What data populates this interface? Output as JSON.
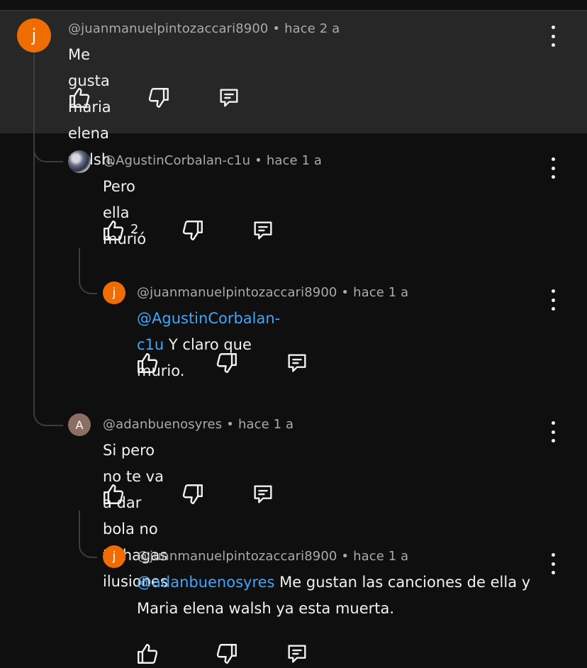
{
  "comments": [
    {
      "author": "@juanmanuelpintozaccari8900",
      "time": "hace 2 a",
      "text": "Me gusta maria elena walsh.",
      "avatar_letter": "j",
      "avatar_color": "#ef6c00",
      "highlighted": true
    },
    {
      "author": "@AgustinCorbalan-c1u",
      "time": "hace 1 a",
      "text": "Pero ella murió",
      "likes": "2",
      "avatar": "profile-photo"
    },
    {
      "author": "@juanmanuelpintozaccari8900",
      "time": "hace 1 a",
      "mention": "@AgustinCorbalan-c1u",
      "text": " Y claro que murio.",
      "avatar_letter": "j",
      "avatar_color": "#ef6c00"
    },
    {
      "author": "@adanbuenosyres",
      "time": "hace 1 a",
      "text": "Si pero no te va a dar bola no te hagas ilusiones",
      "avatar_letter": "A",
      "avatar_color": "#8d6e63"
    },
    {
      "author": "@juanmanuelpintozaccari8900",
      "time": "hace 1 a",
      "mention": "@adanbuenosyres",
      "text": " Me gustan las canciones de ella y",
      "text_line2": "Maria elena walsh ya esta muerta.",
      "avatar_letter": "j",
      "avatar_color": "#ef6c00"
    }
  ],
  "separator": "•",
  "icons": [
    "thumb-up-icon",
    "thumb-down-icon",
    "reply-icon",
    "more-vert-icon"
  ],
  "colors": {
    "background": "#0f0f0f",
    "highlight": "#272727",
    "mention": "#3ea6ff",
    "meta": "#aaaaaa"
  }
}
